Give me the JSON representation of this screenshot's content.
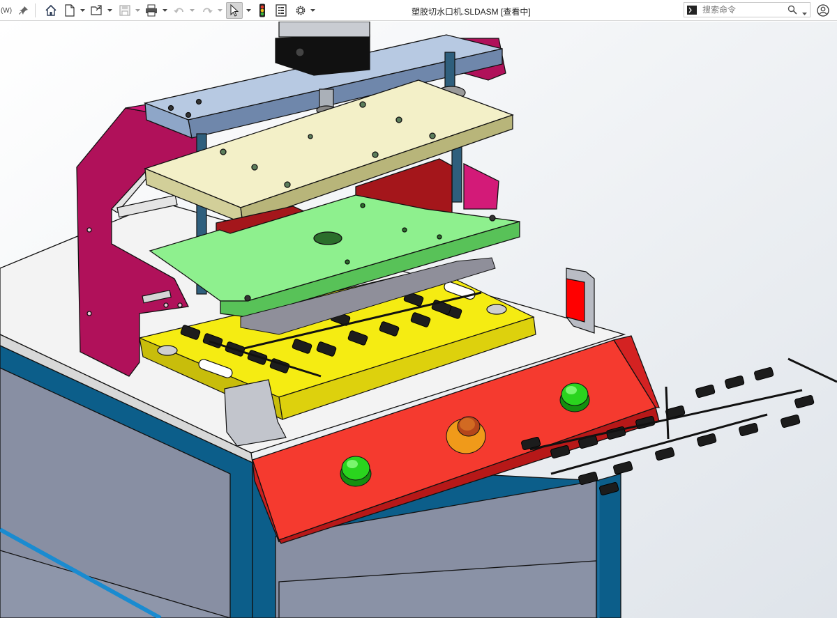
{
  "toolbar": {
    "left_fragment": "(W)",
    "document_title": "塑胶切水口机.SLDASM [查看中]",
    "search": {
      "placeholder": "搜索命令"
    }
  },
  "icons": [
    "pin-icon",
    "home-icon",
    "new-document-icon",
    "open-document-icon",
    "save-icon",
    "print-icon",
    "undo-icon",
    "redo-icon",
    "select-arrow-icon",
    "rebuild-traffic-light-icon",
    "file-properties-icon",
    "options-gear-icon",
    "command-prompt-icon",
    "search-icon",
    "user-account-icon"
  ],
  "viewport": {
    "background_gradient": [
      "#ffffff",
      "#dfe4ea"
    ],
    "colors": {
      "frame_magenta": "#b0115a",
      "plate_blue": "#b7c9e2",
      "plate_cream": "#f3f0c8",
      "plate_green": "#8ef08e",
      "block_darkred": "#a4161b",
      "base_yellow": "#f5ec12",
      "panel_red": "#f53a2f",
      "button_green": "#2ad41e",
      "emergency_stop": "#f09a1a",
      "cabinet_blue": "#0c5e8a",
      "cabinet_panel": "#888fa3",
      "tabletop": "#f3f3f3"
    }
  }
}
